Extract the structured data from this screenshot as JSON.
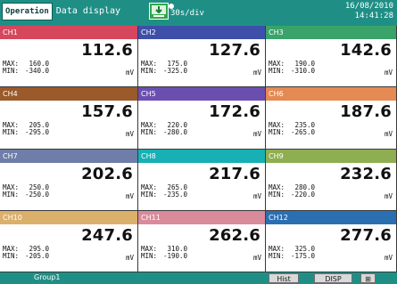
{
  "header": {
    "mode_button": "Operation",
    "screen_title": "Data display",
    "record_icon": "record-status-icon",
    "sample_rate": "30s/div",
    "date": "16/08/2010",
    "time": "14:41:28"
  },
  "channels": [
    {
      "name": "CH1",
      "value": "112.6",
      "max": "160.0",
      "min": "-340.0",
      "unit": "mV",
      "color": "#d6475d"
    },
    {
      "name": "CH2",
      "value": "127.6",
      "max": "175.0",
      "min": "-325.0",
      "unit": "mV",
      "color": "#3e4fa9"
    },
    {
      "name": "CH3",
      "value": "142.6",
      "max": "190.0",
      "min": "-310.0",
      "unit": "mV",
      "color": "#3aa36a"
    },
    {
      "name": "CH4",
      "value": "157.6",
      "max": "205.0",
      "min": "-295.0",
      "unit": "mV",
      "color": "#9a5a2a"
    },
    {
      "name": "CH5",
      "value": "172.6",
      "max": "220.0",
      "min": "-280.0",
      "unit": "mV",
      "color": "#6b4fb0"
    },
    {
      "name": "CH6",
      "value": "187.6",
      "max": "235.0",
      "min": "-265.0",
      "unit": "mV",
      "color": "#e58a52"
    },
    {
      "name": "CH7",
      "value": "202.6",
      "max": "250.0",
      "min": "-250.0",
      "unit": "mV",
      "color": "#6f7ea8"
    },
    {
      "name": "CH8",
      "value": "217.6",
      "max": "265.0",
      "min": "-235.0",
      "unit": "mV",
      "color": "#17b0b4"
    },
    {
      "name": "CH9",
      "value": "232.6",
      "max": "280.0",
      "min": "-220.0",
      "unit": "mV",
      "color": "#8fae52"
    },
    {
      "name": "CH10",
      "value": "247.6",
      "max": "295.0",
      "min": "-205.0",
      "unit": "mV",
      "color": "#dbb06a"
    },
    {
      "name": "CH11",
      "value": "262.6",
      "max": "310.0",
      "min": "-190.0",
      "unit": "mV",
      "color": "#d98a9b"
    },
    {
      "name": "CH12",
      "value": "277.6",
      "max": "325.0",
      "min": "-175.0",
      "unit": "mV",
      "color": "#2b6fb3"
    }
  ],
  "stat_labels": {
    "max": "MAX:",
    "min": "MIN:"
  },
  "footer": {
    "group": "Group1",
    "softkeys": [
      "Hist",
      "DISP",
      "⊞"
    ]
  },
  "colors": {
    "bar": "#1f8f86"
  }
}
